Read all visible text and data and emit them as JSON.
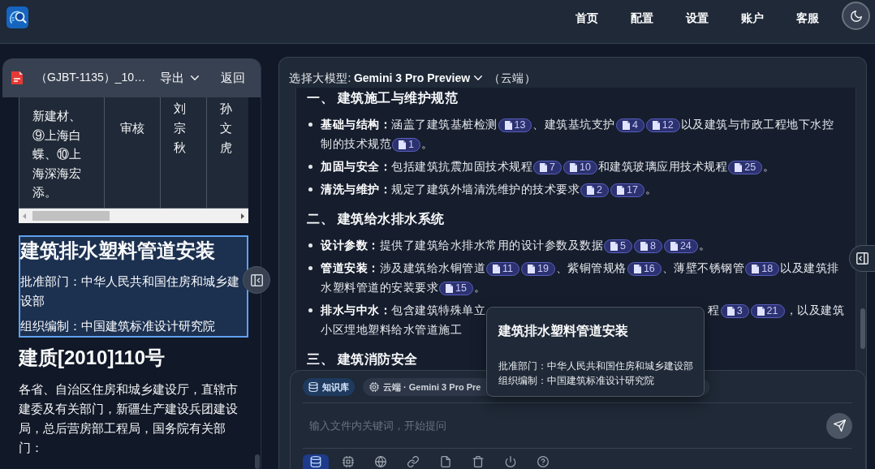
{
  "top_bar": {
    "nav": [
      {
        "label": "首页"
      },
      {
        "label": "配置"
      },
      {
        "label": "设置"
      },
      {
        "label": "账户"
      },
      {
        "label": "客服"
      }
    ]
  },
  "document_panel": {
    "file_name": "（GJBT-1135）_10…",
    "export_label": "导出",
    "back_label": "返回",
    "table": {
      "rows": [
        {
          "cells": [
            "新建材、⑨上海白蝶、⑩上海深海宏添。",
            "审核",
            "刘宗秋",
            "孙文虎"
          ]
        }
      ]
    },
    "highlight": {
      "title": "建筑排水塑料管道安装",
      "lines": [
        "批准部门：中华人民共和国住房和城乡建设部",
        "组织编制：中国建筑标准设计研究院"
      ]
    },
    "heading": "建质[2010]110号",
    "paragraph": "各省、自治区住房和城乡建设厅，直辖市建委及有关部门，新疆生产建设兵团建设局，总后营房部工程局，国务院有关部门："
  },
  "chat_panel": {
    "model_label": "选择大模型:",
    "model_name": "Gemini 3 Pro Preview",
    "model_location": "（云端）",
    "sections": [
      {
        "heading": "一、 建筑施工与维护规范",
        "items": [
          {
            "label": "基础与结构：",
            "parts": [
              {
                "kind": "text",
                "text": "涵盖了建筑基桩检测"
              },
              {
                "kind": "ref",
                "text": "13"
              },
              {
                "kind": "text",
                "text": "、建筑基坑支护"
              },
              {
                "kind": "ref",
                "text": "4"
              },
              {
                "kind": "ref",
                "text": "12"
              },
              {
                "kind": "text",
                "text": "以及建筑与市政工程地下水控制的技术规范"
              },
              {
                "kind": "ref",
                "text": "1"
              },
              {
                "kind": "text",
                "text": "。"
              }
            ]
          },
          {
            "label": "加固与安全：",
            "parts": [
              {
                "kind": "text",
                "text": "包括建筑抗震加固技术规程"
              },
              {
                "kind": "ref",
                "text": "7"
              },
              {
                "kind": "ref",
                "text": "10"
              },
              {
                "kind": "text",
                "text": "和建筑玻璃应用技术规程"
              },
              {
                "kind": "ref",
                "text": "25"
              },
              {
                "kind": "text",
                "text": "。"
              }
            ]
          },
          {
            "label": "清洗与维护：",
            "parts": [
              {
                "kind": "text",
                "text": "规定了建筑外墙清洗维护的技术要求"
              },
              {
                "kind": "ref",
                "text": "2"
              },
              {
                "kind": "ref",
                "text": "17"
              },
              {
                "kind": "text",
                "text": "。"
              }
            ]
          }
        ]
      },
      {
        "heading": "二、 建筑给水排水系统",
        "items": [
          {
            "label": "设计参数：",
            "parts": [
              {
                "kind": "text",
                "text": "提供了建筑给水排水常用的设计参数及数据"
              },
              {
                "kind": "ref",
                "text": "5"
              },
              {
                "kind": "ref",
                "text": "8"
              },
              {
                "kind": "ref",
                "text": "24"
              },
              {
                "kind": "text",
                "text": "。"
              }
            ]
          },
          {
            "label": "管道安装：",
            "parts": [
              {
                "kind": "text",
                "text": "涉及建筑给水铜管道"
              },
              {
                "kind": "ref",
                "text": "11"
              },
              {
                "kind": "ref",
                "text": "19"
              },
              {
                "kind": "text",
                "text": "、紫铜管规格"
              },
              {
                "kind": "ref",
                "text": "16"
              },
              {
                "kind": "text",
                "text": "、薄壁不锈钢管"
              },
              {
                "kind": "ref",
                "text": "18"
              },
              {
                "kind": "text",
                "text": "以及建筑排水塑料管道的安装要求"
              },
              {
                "kind": "ref",
                "text": "15"
              },
              {
                "kind": "text",
                "text": "。"
              }
            ]
          },
          {
            "label": "排水与中水：",
            "parts": [
              {
                "kind": "text",
                "text": "包含建筑特殊单立"
              },
              {
                "kind": "covered"
              },
              {
                "kind": "text",
                "text": "程"
              },
              {
                "kind": "ref",
                "text": "3"
              },
              {
                "kind": "ref",
                "text": "21"
              },
              {
                "kind": "text",
                "text": "，以及建筑"
              },
              {
                "kind": "break"
              },
              {
                "kind": "text",
                "text": "小区埋地塑料给水管道施工"
              }
            ]
          }
        ]
      },
      {
        "heading": "三、 建筑消防安全"
      }
    ]
  },
  "tooltip": {
    "title": "建筑排水塑料管道安装",
    "lines": [
      "批准部门：中华人民共和国住房和城乡建设部",
      "组织编制：中国建筑标准设计研究院"
    ]
  },
  "composer": {
    "chips": [
      {
        "kind": "knowledge_base",
        "label": "知识库"
      },
      {
        "kind": "model",
        "label": "云端 · Gemini 3 Pro Pre"
      }
    ],
    "placeholder": "输入文件内关键词，开始提问",
    "tools": [
      {
        "selected": true
      },
      {
        "selected": false
      },
      {
        "selected": false
      },
      {
        "selected": false
      },
      {
        "selected": false
      },
      {
        "selected": false
      },
      {
        "selected": false
      },
      {
        "selected": false
      }
    ]
  }
}
